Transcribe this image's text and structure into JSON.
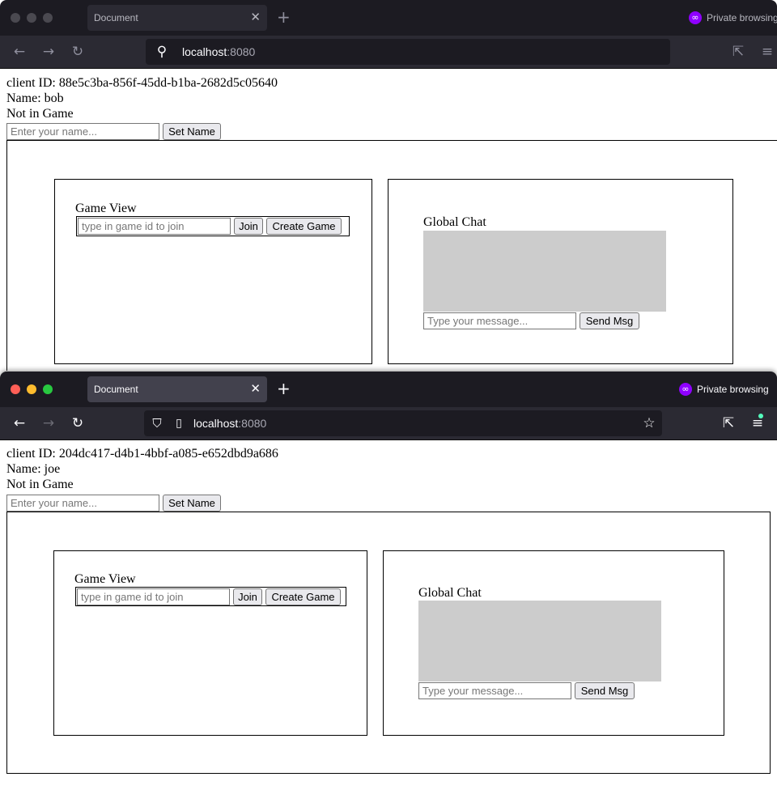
{
  "windows": [
    {
      "tab_title": "Document",
      "tab_close": "✕",
      "new_tab": "+",
      "private_label": "Private browsing",
      "url_host": "localhost",
      "url_port": ":8080",
      "client_id_line": "client ID: 88e5c3ba-856f-45dd-b1ba-2682d5c05640",
      "name_line": "Name: bob",
      "status_line": "Not in Game",
      "name_input_placeholder": "Enter your name...",
      "set_name_label": "Set Name",
      "game_view_label": "Game View",
      "game_id_placeholder": "type in game id to join",
      "join_label": "Join",
      "create_game_label": "Create Game",
      "chat_label": "Global Chat",
      "message_placeholder": "Type your message...",
      "send_label": "Send Msg"
    },
    {
      "tab_title": "Document",
      "tab_close": "✕",
      "new_tab": "+",
      "private_label": "Private browsing",
      "url_host": "localhost",
      "url_port": ":8080",
      "client_id_line": "client ID: 204dc417-d4b1-4bbf-a085-e652dbd9a686",
      "name_line": "Name: joe",
      "status_line": "Not in Game",
      "name_input_placeholder": "Enter your name...",
      "set_name_label": "Set Name",
      "game_view_label": "Game View",
      "game_id_placeholder": "type in game id to join",
      "join_label": "Join",
      "create_game_label": "Create Game",
      "chat_label": "Global Chat",
      "message_placeholder": "Type your message...",
      "send_label": "Send Msg"
    }
  ],
  "colors": {
    "tab_strip": "#1c1b22",
    "toolbar": "#2b2a33",
    "close_dot": "#ff5f57",
    "minimize_dot": "#febc2e",
    "zoom_dot": "#28c840",
    "inactive_dot": "#4a4950",
    "private_accent": "#8f00ff",
    "chat_area": "#cccccc",
    "button_face": "#e9e9ed"
  }
}
